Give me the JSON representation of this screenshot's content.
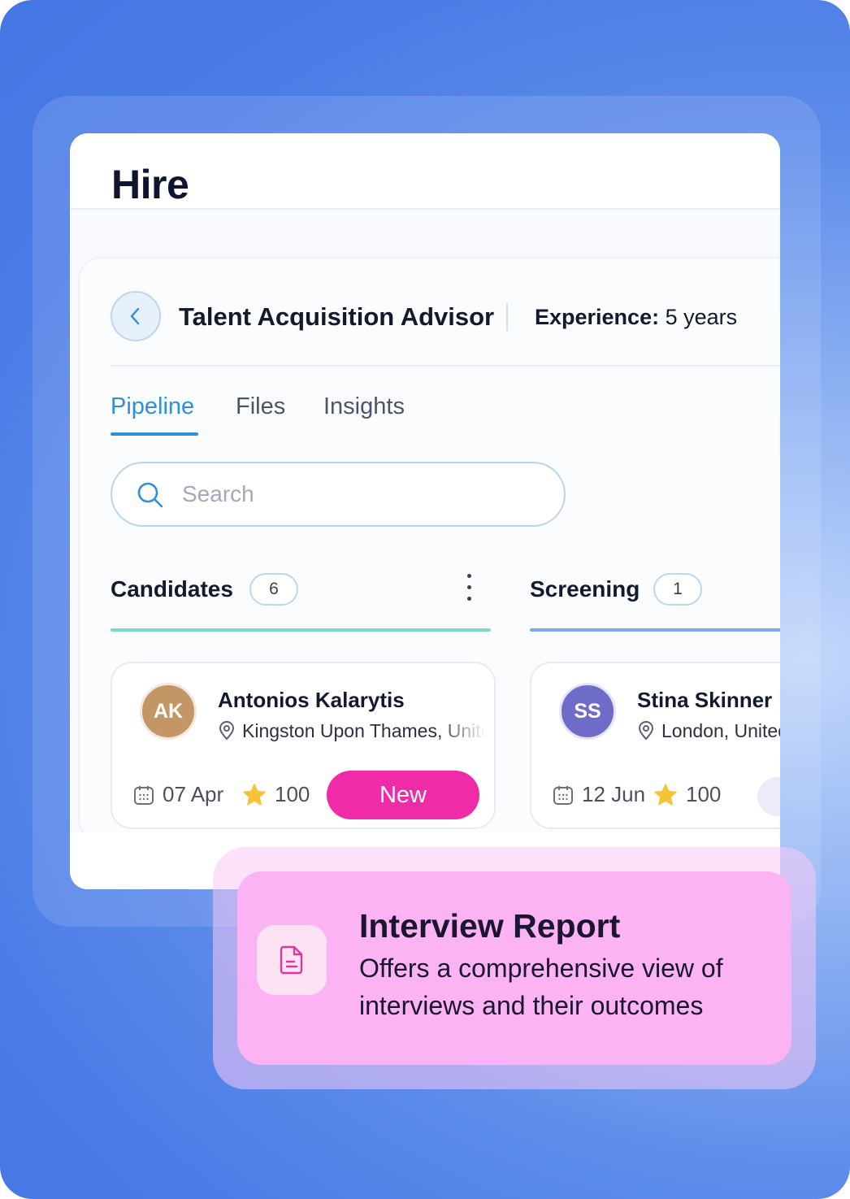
{
  "app": {
    "title": "Hire"
  },
  "job": {
    "title": "Talent Acquisition Advisor",
    "experience_label": "Experience:",
    "experience_value": "5 years"
  },
  "tabs": [
    {
      "label": "Pipeline",
      "active": true
    },
    {
      "label": "Files",
      "active": false
    },
    {
      "label": "Insights",
      "active": false
    }
  ],
  "search": {
    "placeholder": "Search",
    "value": ""
  },
  "columns": [
    {
      "title": "Candidates",
      "count": "6",
      "accent": "#7ed9c6",
      "card": {
        "initials": "AK",
        "avatar_color": "#c49565",
        "name": "Antonios Kalarytis",
        "location": "Kingston Upon Thames, United Kingdom",
        "date": "07 Apr",
        "score": "100",
        "status": "New"
      }
    },
    {
      "title": "Screening",
      "count": "1",
      "accent": "#7fa9ee",
      "card": {
        "initials": "SS",
        "avatar_color": "#6f6bc8",
        "name": "Stina Skinner",
        "location": "London, United Kingdom",
        "date": "12 Jun",
        "score": "100"
      }
    }
  ],
  "feature": {
    "title": "Interview Report",
    "description": "Offers a comprehensive view of interviews and their outcomes",
    "icon": "document-icon"
  },
  "colors": {
    "accent": "#2f8fdc",
    "status_new": "#ef2ba8",
    "feature_bg": "#fbb3f4"
  }
}
